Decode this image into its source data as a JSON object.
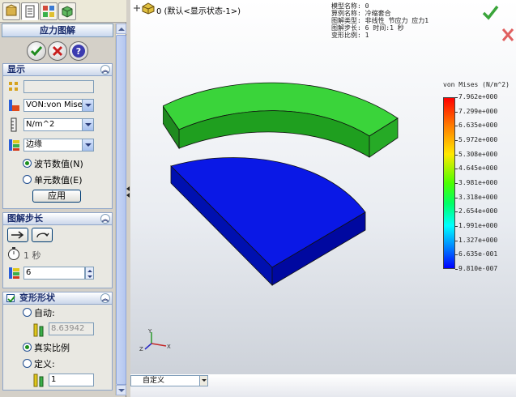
{
  "panel": {
    "title": "应力图解",
    "display_section": {
      "title": "显示",
      "component_field": "",
      "result_type": "VON:von Mises 应",
      "units": "N/m^2",
      "display_mode": "边缘",
      "radio_nodal": "波节数值(N)",
      "radio_element": "单元数值(E)",
      "radio_selected": "nodal",
      "apply_button": "应用"
    },
    "step_section": {
      "title": "图解步长",
      "time_value": "1 秒",
      "step_value": "6"
    },
    "deform_section": {
      "title": "变形形状",
      "enabled": true,
      "radio_auto": "自动:",
      "auto_value": "8.63942",
      "radio_true_scale": "真实比例",
      "radio_defined": "定义:",
      "defined_value": "1",
      "radio_selected": "true_scale"
    }
  },
  "viewport": {
    "tree_label": "0  (默认<显示状态-1>)",
    "info": {
      "model_name": "模型名称: 0",
      "study_name": "算例名称: 冷缩套合",
      "plot_type": "图解类型: 非线性 节应力 应力1",
      "plot_step": "图解步长: 6    时间:1 秒",
      "deform_scale": "变形比例: 1"
    },
    "legend": {
      "title": "von Mises (N/m^2)",
      "values": [
        "7.962e+000",
        "7.299e+000",
        "6.635e+000",
        "5.972e+000",
        "5.308e+000",
        "4.645e+000",
        "3.981e+000",
        "3.318e+000",
        "2.654e+000",
        "1.991e+000",
        "1.327e+000",
        "6.635e-001",
        "9.810e-007"
      ]
    },
    "view_combo": "自定义",
    "colors": {
      "ring": "#3ad43a",
      "ring_dark": "#1f8a1f",
      "plate": "#0a18e6",
      "plate_dark": "#0008a0"
    }
  },
  "confirm": {
    "ok_icon": "green-checkmark-icon",
    "cancel_icon": "red-x-icon"
  }
}
